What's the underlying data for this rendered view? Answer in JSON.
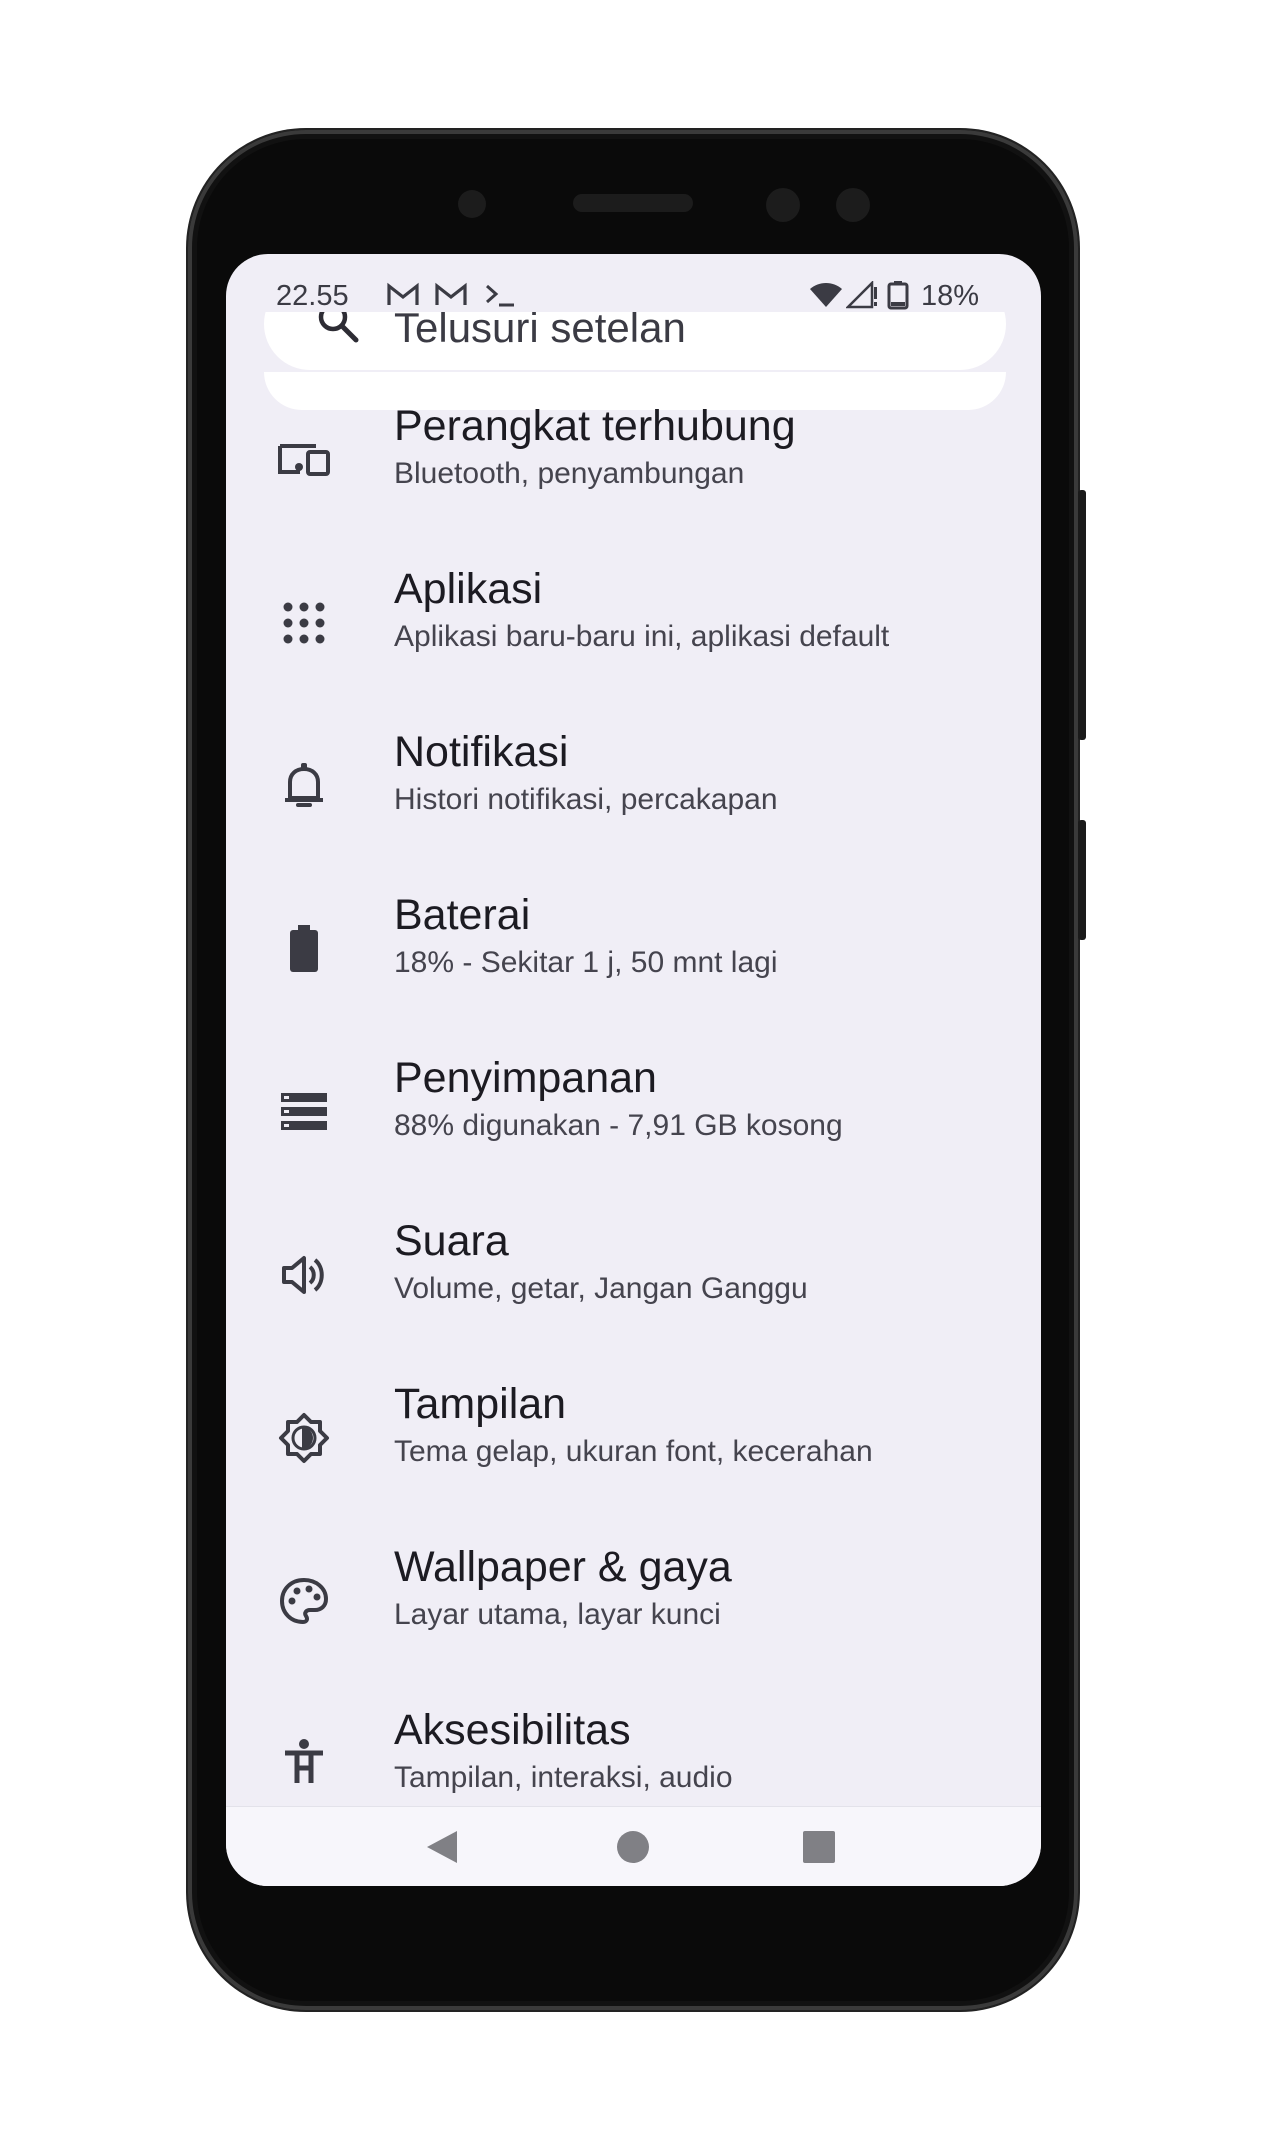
{
  "status_bar": {
    "time": "22.55",
    "battery_percent": "18%",
    "left_icons": [
      "gmail-icon",
      "gmail-icon",
      "terminal-icon"
    ],
    "right_icons": [
      "wifi-icon",
      "signal-icon",
      "battery-icon"
    ]
  },
  "search": {
    "placeholder": "Telusuri setelan"
  },
  "settings": [
    {
      "title": "Perangkat terhubung",
      "subtitle": "Bluetooth, penyambungan",
      "icon": "connected-devices-icon"
    },
    {
      "title": "Aplikasi",
      "subtitle": "Aplikasi baru-baru ini, aplikasi default",
      "icon": "apps-icon"
    },
    {
      "title": "Notifikasi",
      "subtitle": "Histori notifikasi, percakapan",
      "icon": "bell-icon"
    },
    {
      "title": "Baterai",
      "subtitle": "18% - Sekitar 1 j, 50 mnt lagi",
      "icon": "battery-icon"
    },
    {
      "title": "Penyimpanan",
      "subtitle": "88% digunakan - 7,91 GB kosong",
      "icon": "storage-icon"
    },
    {
      "title": "Suara",
      "subtitle": "Volume, getar, Jangan Ganggu",
      "icon": "volume-icon"
    },
    {
      "title": "Tampilan",
      "subtitle": "Tema gelap, ukuran font, kecerahan",
      "icon": "brightness-icon"
    },
    {
      "title": "Wallpaper & gaya",
      "subtitle": "Layar utama, layar kunci",
      "icon": "palette-icon"
    },
    {
      "title": "Aksesibilitas",
      "subtitle": "Tampilan, interaksi, audio",
      "icon": "accessibility-icon"
    }
  ],
  "navigation": [
    "back-icon",
    "home-icon",
    "recents-icon"
  ]
}
